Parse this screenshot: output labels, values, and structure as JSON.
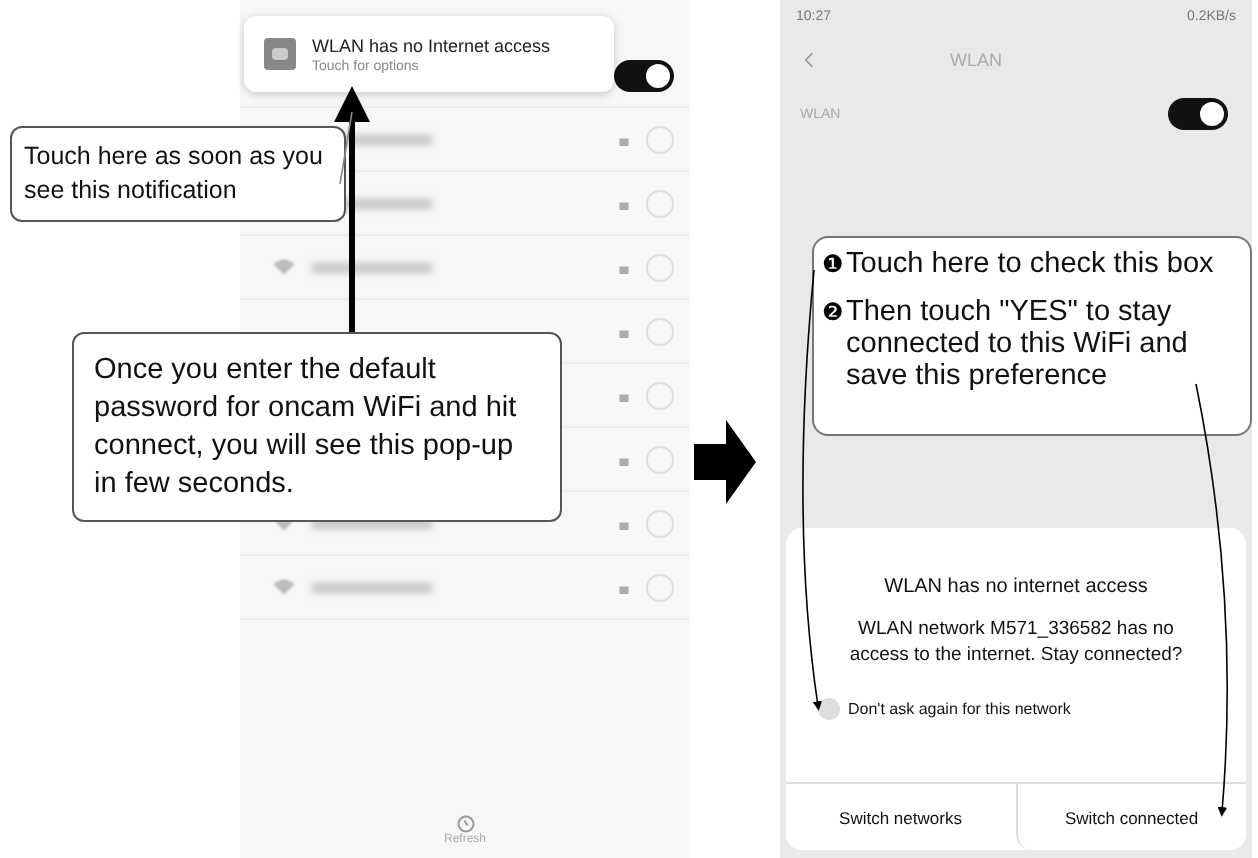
{
  "left_screen": {
    "notification": {
      "title": "WLAN has no Internet access",
      "subtitle": "Touch for options"
    },
    "wlan_on": true,
    "refresh_label": "Refresh"
  },
  "callouts": [
    "Touch here as soon as you see this notification",
    "Once you enter the default password for oncam WiFi and hit connect, you will see this pop-up in few seconds."
  ],
  "right_screen": {
    "status_time": "10:27",
    "status_speed": "0.2KB/s",
    "title": "WLAN",
    "wlan_label": "WLAN",
    "wlan_on": true,
    "steps": [
      {
        "marker": "❶",
        "text": "Touch here to check this box"
      },
      {
        "marker": "❷",
        "text": "Then touch \"YES\" to stay connected to this WiFi and save this preference"
      }
    ],
    "dialog": {
      "title": "WLAN has no internet access",
      "message": "WLAN network M571_336582 has no access to the internet. Stay connected?",
      "checkbox": {
        "label": "Don't ask again for this network",
        "checked": false
      },
      "buttons": [
        "Switch networks",
        "Switch connected"
      ]
    }
  }
}
